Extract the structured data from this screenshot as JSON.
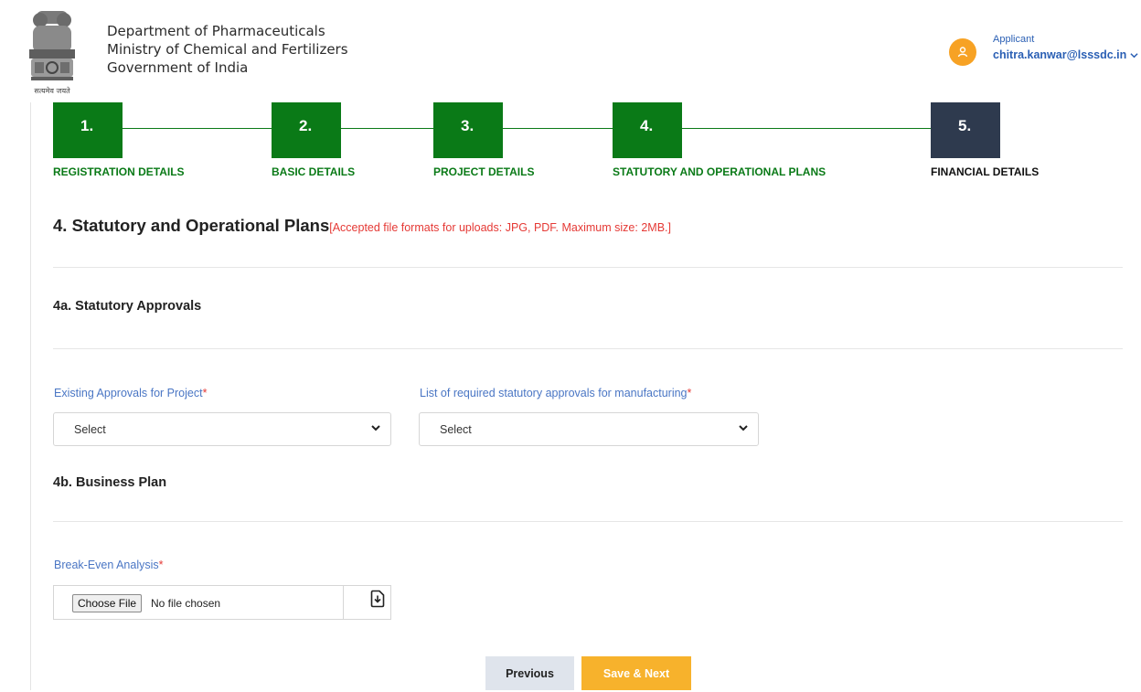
{
  "header": {
    "emblem_motto": "सत्यमेव जयते",
    "dept_lines": [
      "Department of Pharmaceuticals",
      "Ministry of Chemical and Fertilizers",
      "Government of India"
    ],
    "user_role": "Applicant",
    "user_email": "chitra.kanwar@lsssdc.in"
  },
  "steps": [
    {
      "number": "1.",
      "label": "REGISTRATION DETAILS",
      "state": "completed"
    },
    {
      "number": "2.",
      "label": "BASIC DETAILS",
      "state": "completed"
    },
    {
      "number": "3.",
      "label": "PROJECT DETAILS",
      "state": "completed"
    },
    {
      "number": "4.",
      "label": "STATUTORY AND OPERATIONAL PLANS",
      "state": "completed"
    },
    {
      "number": "5.",
      "label": "FINANCIAL DETAILS",
      "state": "current"
    }
  ],
  "section": {
    "title": "4. Statutory and Operational Plans",
    "note": "[Accepted file formats for uploads: JPG, PDF. Maximum size: 2MB.]"
  },
  "statutory": {
    "heading": "4a. Statutory Approvals",
    "existing_label": "Existing Approvals for Project",
    "existing_value": "Select",
    "required_label": "List of required statutory approvals for manufacturing",
    "required_value": "Select"
  },
  "business": {
    "heading": "4b. Business Plan",
    "breakeven_label": "Break-Even Analysis",
    "choose_file": "Choose File",
    "no_file": "No file chosen"
  },
  "required_mark": "*",
  "buttons": {
    "previous": "Previous",
    "save_next": "Save & Next"
  },
  "colors": {
    "step_done": "#0a7a17",
    "step_current": "#2e3a4e",
    "accent": "#f7b22c",
    "label_blue": "#4a76c4",
    "note_red": "#e53935"
  },
  "icons": {
    "avatar": "user-icon",
    "dropdown": "chevron-down-icon",
    "download": "file-download-icon"
  }
}
